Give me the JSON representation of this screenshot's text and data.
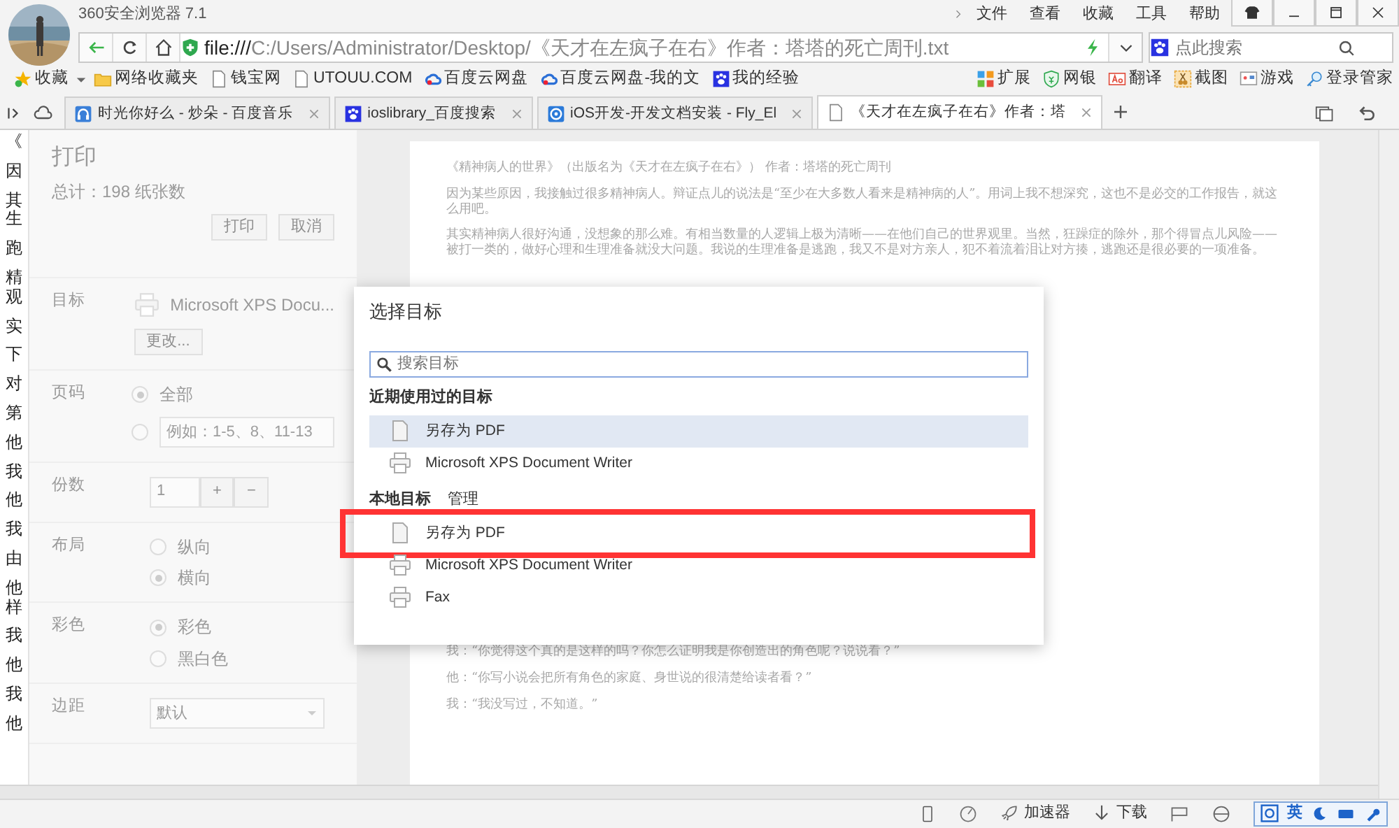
{
  "window": {
    "title": "360安全浏览器 7.1"
  },
  "menu": [
    "文件",
    "查看",
    "收藏",
    "工具",
    "帮助"
  ],
  "address_bar": {
    "scheme": "file:///",
    "path": "C:/Users/Administrator/Desktop/《天才在左疯子在右》作者：塔塔的死亡周刊.txt"
  },
  "search": {
    "placeholder": "点此搜索"
  },
  "bookmarks": [
    {
      "label": "收藏",
      "kind": "star"
    },
    {
      "label": "网络收藏夹",
      "kind": "folder"
    },
    {
      "label": "钱宝网",
      "kind": "page"
    },
    {
      "label": "UTOUU.COM",
      "kind": "page"
    },
    {
      "label": "百度云网盘",
      "kind": "cloud"
    },
    {
      "label": "百度云网盘-我的文",
      "kind": "cloud"
    },
    {
      "label": "我的经验",
      "kind": "paw"
    }
  ],
  "tools": [
    {
      "label": "扩展",
      "kind": "blocks"
    },
    {
      "label": "网银",
      "kind": "shield"
    },
    {
      "label": "翻译",
      "kind": "translate"
    },
    {
      "label": "截图",
      "kind": "scissors"
    },
    {
      "label": "游戏",
      "kind": "game"
    },
    {
      "label": "登录管家",
      "kind": "key"
    }
  ],
  "tabs": [
    {
      "title": "时光你好么 - 炒朵 - 百度音乐",
      "kind": "music",
      "selected": false
    },
    {
      "title": "ioslibrary_百度搜索",
      "kind": "paw",
      "selected": false
    },
    {
      "title": "iOS开发-开发文档安装 - Fly_El",
      "kind": "globe",
      "selected": false
    },
    {
      "title": "《天才在左疯子在右》作者：塔",
      "kind": "page",
      "selected": true
    }
  ],
  "background_text": [
    "《",
    "因",
    "其生",
    "跑",
    "精观",
    "实",
    "下",
    "对",
    "第",
    "他",
    "我",
    "他",
    "我",
    "由",
    "他样",
    "我",
    "他",
    "我",
    "他"
  ],
  "print_panel": {
    "title": "打印",
    "total": "总计：198 纸张数",
    "buttons": [
      "打印",
      "取消"
    ],
    "rows": [
      {
        "label": "目标",
        "kind": "destination",
        "printer": "Microsoft XPS Docu...",
        "button": "更改..."
      },
      {
        "label": "页码",
        "kind": "radio",
        "options": [
          {
            "label": "全部",
            "selected": true
          },
          {
            "placeholder": "例如：1-5、8、11-13",
            "selected": false
          }
        ]
      },
      {
        "label": "份数",
        "kind": "copies",
        "value": "1",
        "plus": "+",
        "minus": "−"
      },
      {
        "label": "布局",
        "kind": "radio",
        "options": [
          {
            "label": "纵向",
            "selected": false
          },
          {
            "label": "横向",
            "selected": true
          }
        ]
      },
      {
        "label": "彩色",
        "kind": "radio",
        "options": [
          {
            "label": "彩色",
            "selected": true
          },
          {
            "label": "黑白色",
            "selected": false
          }
        ]
      },
      {
        "label": "边距",
        "kind": "select",
        "value": "默认"
      }
    ]
  },
  "preview": {
    "paragraphs": [
      "《精神病人的世界》（出版名为《天才在左疯子在右》） 作者：塔塔的死亡周刊",
      "因为某些原因，我接触过很多精神病人。辩证点儿的说法是“至少在大多数人看来是精神病的人”。用词上我不想深究，这也不是必交的工作报告，就这么用吧。",
      "其实精神病人很好沟通，没想象的那么难。有相当数量的人逻辑上极为清晰——在他们自己的世界观里。当然，狂躁症的除外，那个得冒点儿风险——被打一类的，做好心理和生理准备就没大问题。我说的生理准备是逃跑，我又不是对方亲人，犯不着流着泪让对方揍，逃跑还是很必要的一项准备。"
    ],
    "lower_paragraphs": [
      "我：“你觉得这个真的是这样的吗？你怎么证明我是你创造出的角色呢？说说看？”",
      "他：“你写小说会把所有角色的家庭、身世说的很清楚给读者看？”",
      "我：“我没写过，不知道。”"
    ]
  },
  "dialog": {
    "title": "选择目标",
    "search": {
      "placeholder": "搜索目标"
    },
    "sections": [
      {
        "title": "近期使用过的目标",
        "items": [
          {
            "label": "另存为 PDF",
            "kind": "pdf",
            "selected": true,
            "highlighted": false
          },
          {
            "label": "Microsoft XPS Document Writer",
            "kind": "printer",
            "selected": false,
            "highlighted": false
          }
        ]
      },
      {
        "title": "本地目标",
        "link": "管理",
        "items": [
          {
            "label": "另存为 PDF",
            "kind": "pdf",
            "selected": false,
            "highlighted": true
          },
          {
            "label": "Microsoft XPS Document Writer",
            "kind": "printer",
            "selected": false,
            "highlighted": false
          },
          {
            "label": "Fax",
            "kind": "printer",
            "selected": false,
            "highlighted": false
          }
        ]
      }
    ]
  },
  "status_bar": {
    "items": [
      {
        "label": "加速器",
        "kind": "rocket"
      },
      {
        "label": "下载",
        "kind": "download"
      }
    ],
    "ime": "英"
  }
}
